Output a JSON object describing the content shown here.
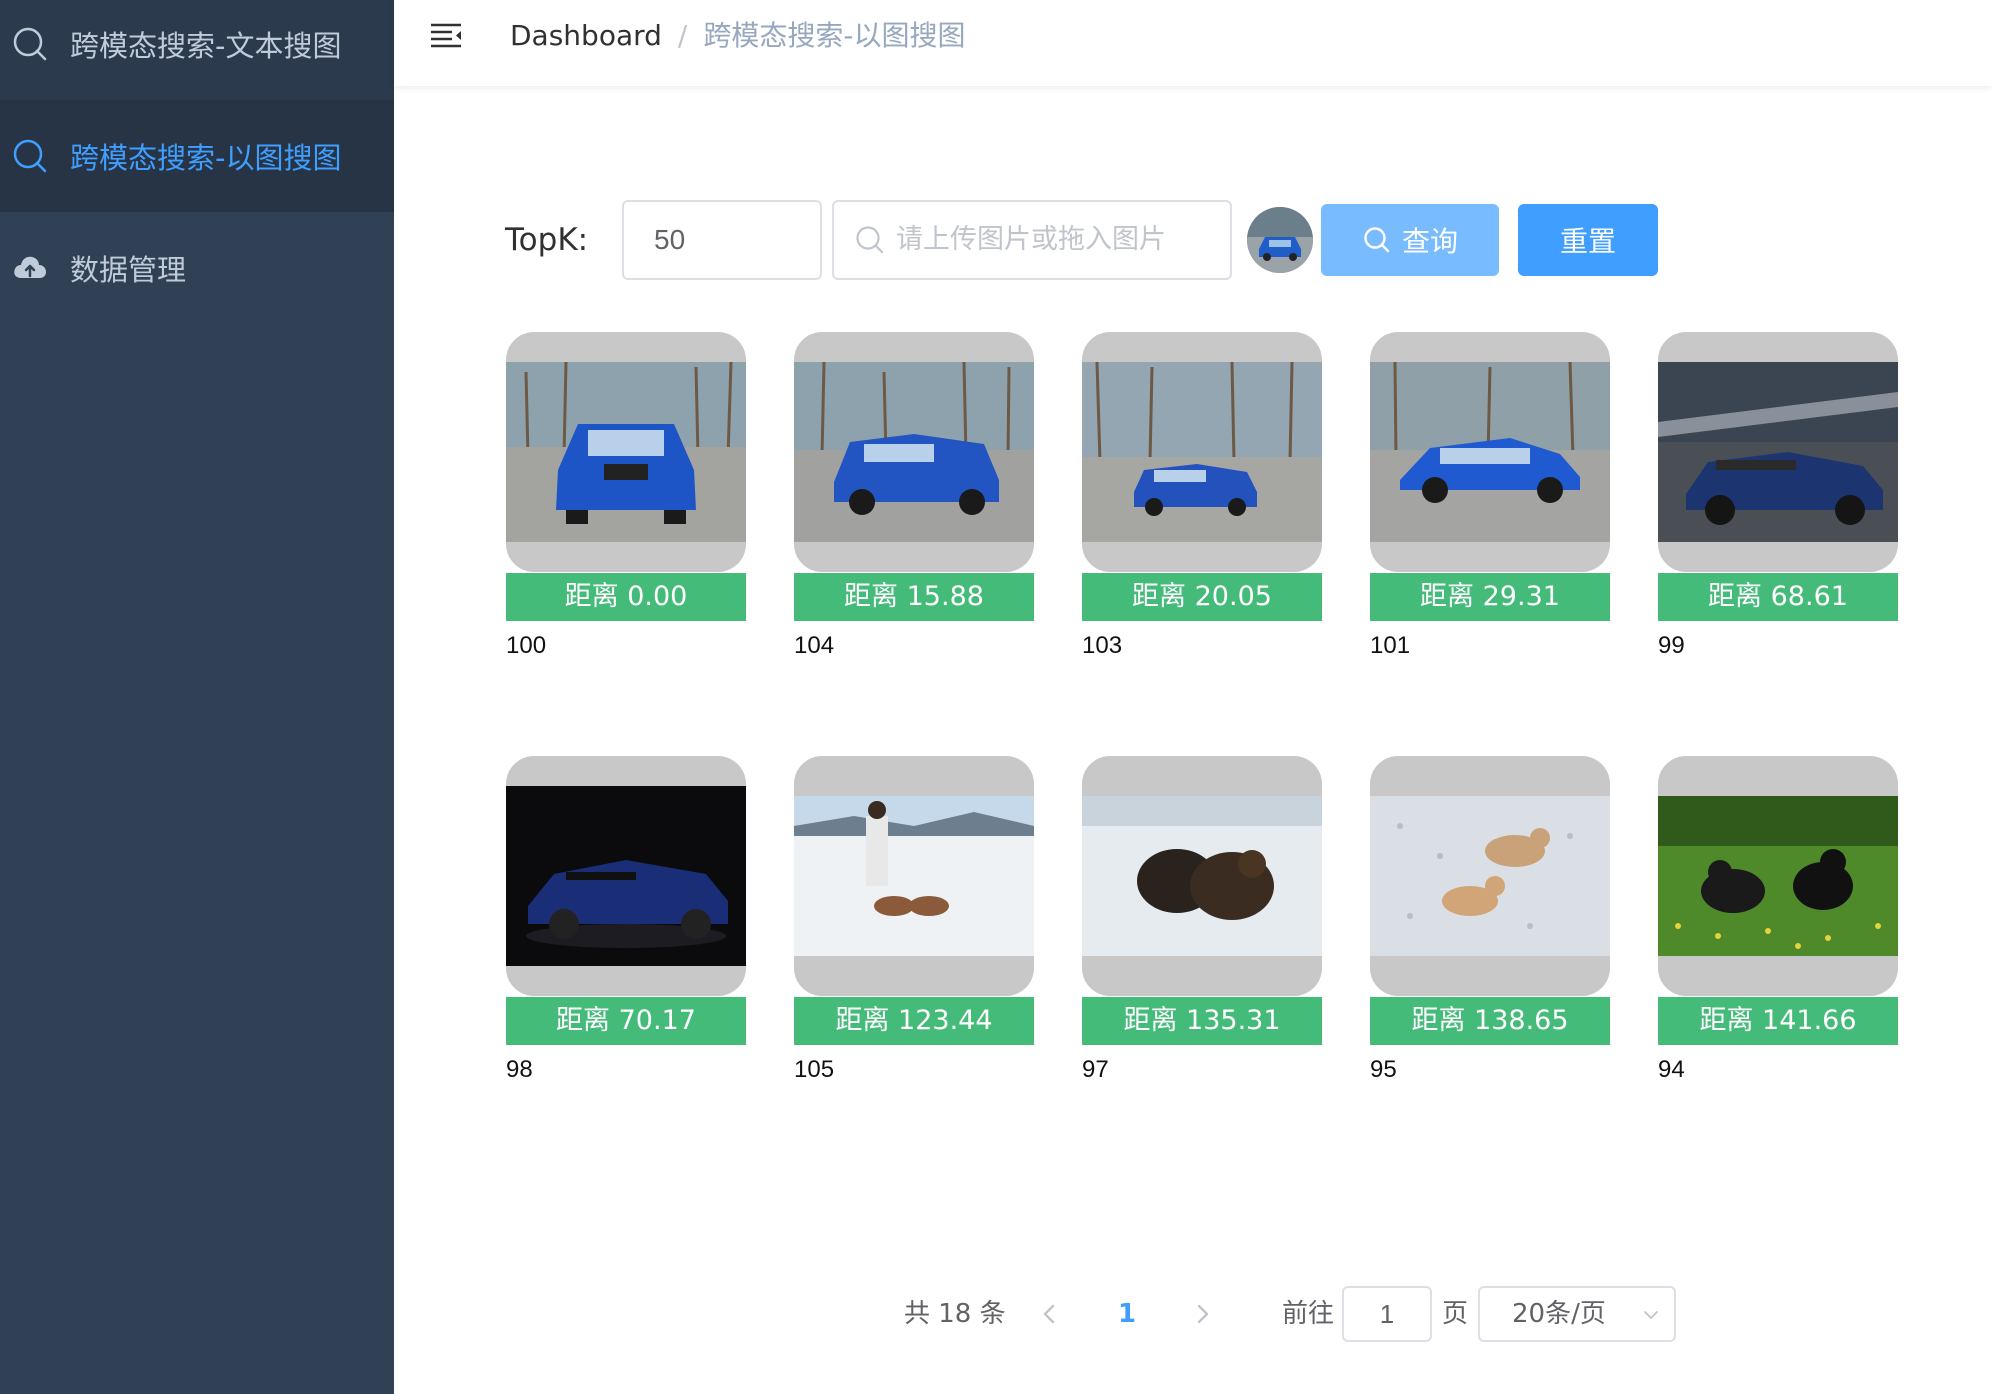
{
  "sidebar": {
    "items": [
      {
        "label": "跨模态搜索-文本搜图",
        "icon": "search-icon",
        "state": "normal"
      },
      {
        "label": "跨模态搜索-以图搜图",
        "icon": "search-icon",
        "state": "active"
      },
      {
        "label": "数据管理",
        "icon": "cloud-upload-icon",
        "state": "normal"
      }
    ]
  },
  "header": {
    "breadcrumb_home": "Dashboard",
    "breadcrumb_sep": "/",
    "breadcrumb_current": "跨模态搜索-以图搜图"
  },
  "search": {
    "topk_label": "TopK:",
    "topk_value": "50",
    "upload_placeholder": "请上传图片或拖入图片",
    "query_label": "查询",
    "reset_label": "重置"
  },
  "results": [
    {
      "distance": "距离 0.00",
      "id": "100",
      "subject": "blue-suv-front"
    },
    {
      "distance": "距离 15.88",
      "id": "104",
      "subject": "blue-suv-threequarter"
    },
    {
      "distance": "距离 20.05",
      "id": "103",
      "subject": "blue-suv-far"
    },
    {
      "distance": "距离 29.31",
      "id": "101",
      "subject": "blue-suv-side"
    },
    {
      "distance": "距离 68.61",
      "id": "99",
      "subject": "blue-convertible-track"
    },
    {
      "distance": "距离 70.17",
      "id": "98",
      "subject": "blue-convertible-dark"
    },
    {
      "distance": "距离 123.44",
      "id": "105",
      "subject": "woman-huskies-snow"
    },
    {
      "distance": "距离 135.31",
      "id": "97",
      "subject": "dogs-snow"
    },
    {
      "distance": "距离 138.65",
      "id": "95",
      "subject": "dogs-playing-snow"
    },
    {
      "distance": "距离 141.66",
      "id": "94",
      "subject": "dogs-meadow"
    }
  ],
  "pagination": {
    "total": "共 18 条",
    "current_page": "1",
    "goto_label": "前往",
    "jump_value": "1",
    "page_suffix": "页",
    "page_size": "20条/页"
  },
  "colors": {
    "sidebar_bg": "#304156",
    "active_text": "#409eff",
    "distance_badge": "#45bb7a",
    "query_button": "#79bbff",
    "reset_button": "#409eff"
  }
}
